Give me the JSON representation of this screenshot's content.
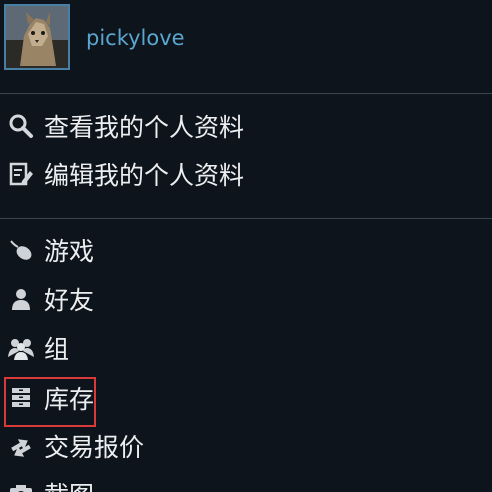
{
  "profile": {
    "username": "pickylove"
  },
  "menu_profile": [
    {
      "label": "查看我的个人资料",
      "icon": "search-icon"
    },
    {
      "label": "编辑我的个人资料",
      "icon": "edit-icon"
    }
  ],
  "menu_main": [
    {
      "label": "游戏",
      "icon": "game-controller-icon"
    },
    {
      "label": "好友",
      "icon": "friend-icon"
    },
    {
      "label": "组",
      "icon": "group-icon"
    },
    {
      "label": "库存",
      "icon": "inventory-icon"
    },
    {
      "label": "交易报价",
      "icon": "trade-icon"
    },
    {
      "label": "截图",
      "icon": "screenshot-icon"
    }
  ],
  "colors": {
    "background": "#0e141b",
    "username": "#5aa6cf",
    "highlight": "#d83a3a"
  }
}
